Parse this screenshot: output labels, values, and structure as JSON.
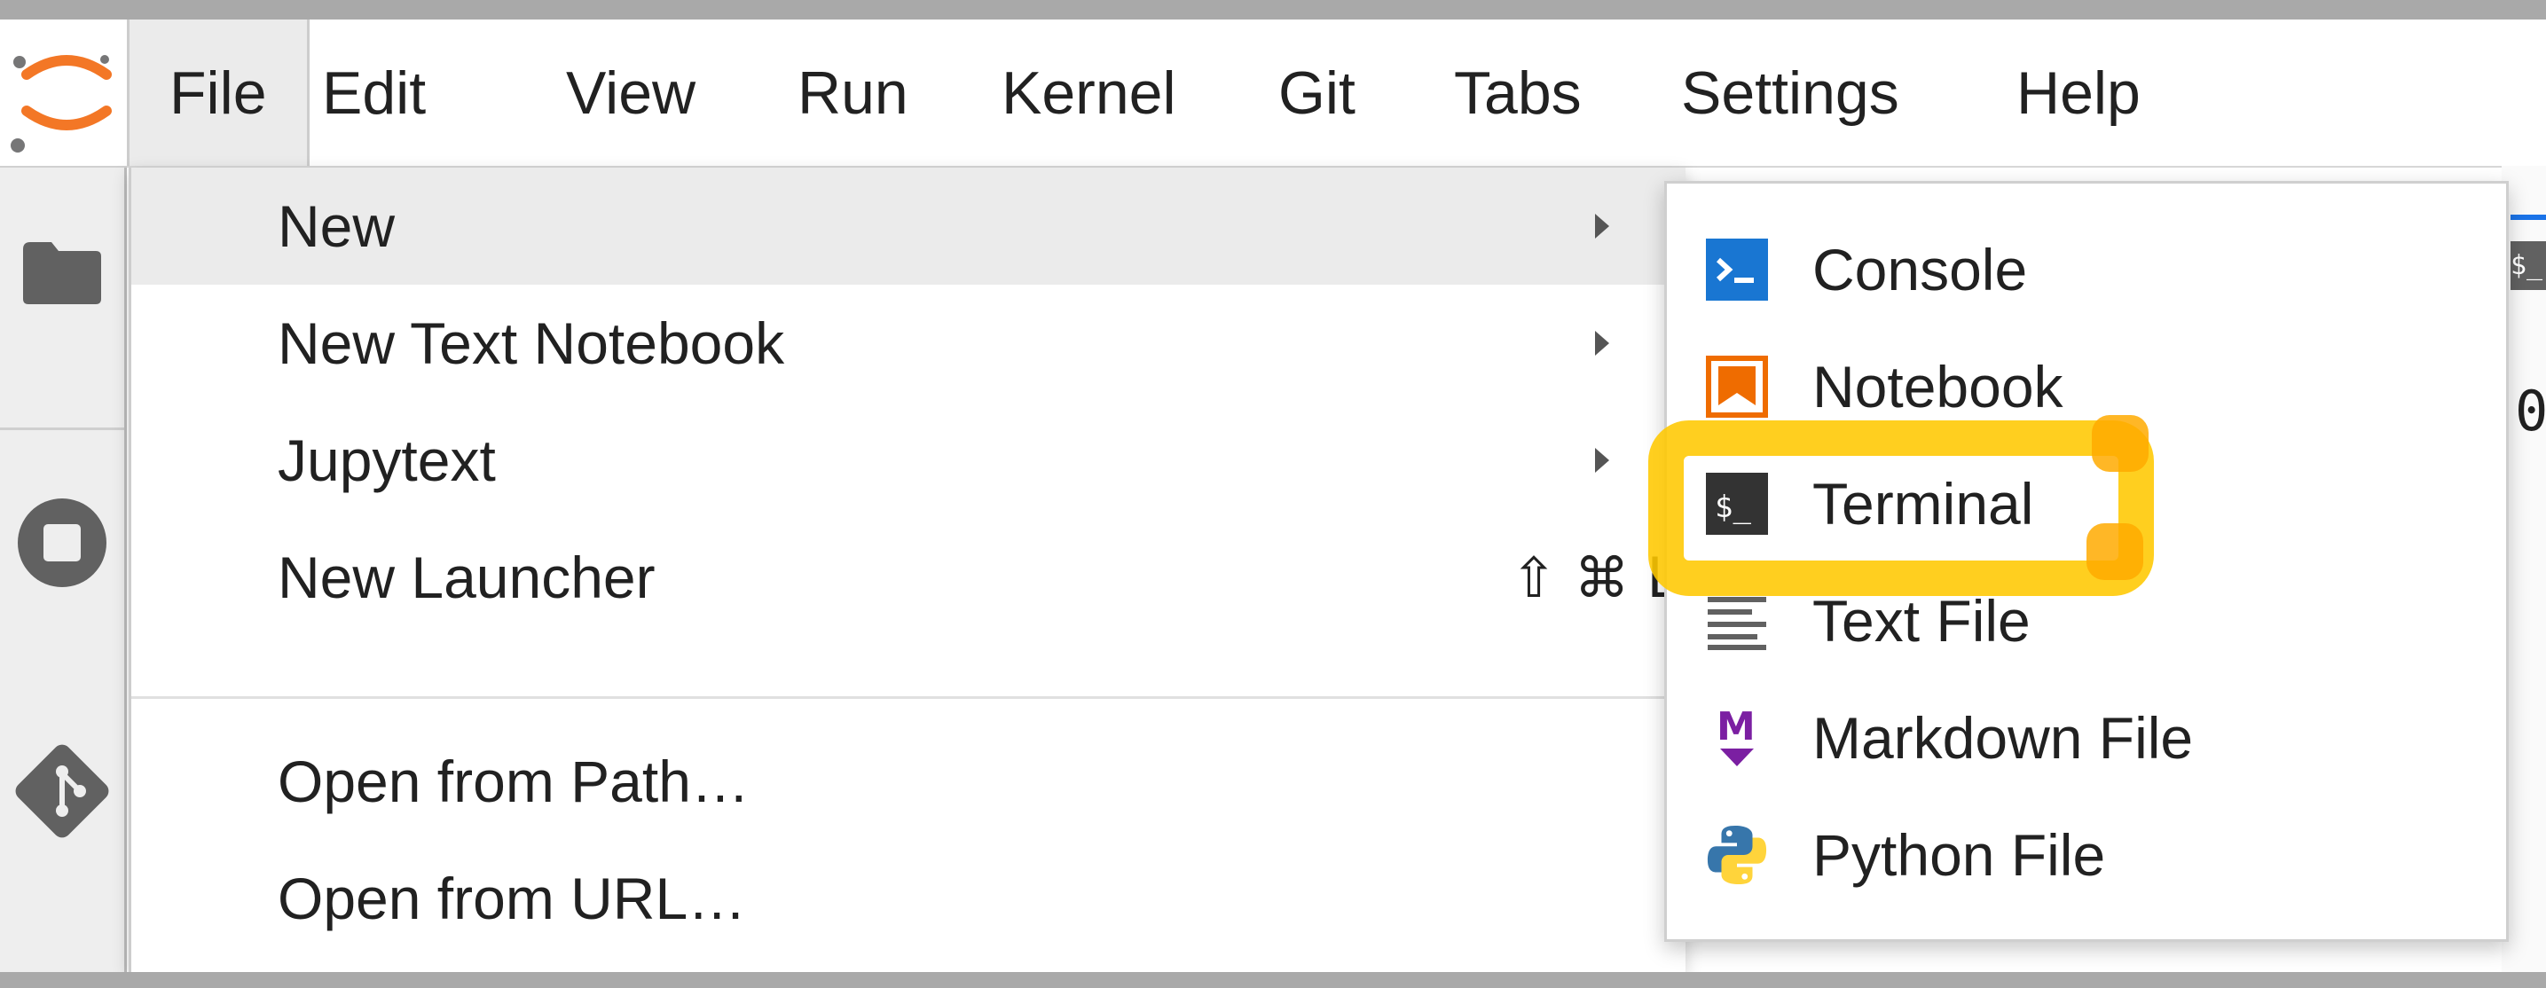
{
  "menubar": {
    "items": [
      {
        "label": "File"
      },
      {
        "label": "Edit"
      },
      {
        "label": "View"
      },
      {
        "label": "Run"
      },
      {
        "label": "Kernel"
      },
      {
        "label": "Git"
      },
      {
        "label": "Tabs"
      },
      {
        "label": "Settings"
      },
      {
        "label": "Help"
      }
    ],
    "active": "File"
  },
  "sidebar": {
    "icons": [
      "jupyter-logo",
      "folder-icon",
      "running-icon",
      "git-icon"
    ]
  },
  "file_menu": {
    "items": [
      {
        "label": "New",
        "submenu": true
      },
      {
        "label": "New Text Notebook",
        "submenu": true
      },
      {
        "label": "Jupytext",
        "submenu": true
      },
      {
        "label": "New Launcher",
        "shortcut": "⇧ ⌘ L"
      },
      {
        "label": "Open from Path…"
      },
      {
        "label": "Open from URL…"
      }
    ]
  },
  "new_submenu": {
    "items": [
      {
        "label": "Console",
        "icon": "console-icon"
      },
      {
        "label": "Notebook",
        "icon": "notebook-icon"
      },
      {
        "label": "Terminal",
        "icon": "terminal-icon"
      },
      {
        "label": "Text File",
        "icon": "text-file-icon"
      },
      {
        "label": "Markdown File",
        "icon": "markdown-icon"
      },
      {
        "label": "Python File",
        "icon": "python-icon"
      }
    ],
    "highlighted": "Terminal"
  },
  "background": {
    "tab_icon_text": "$_",
    "partial_text": "0"
  },
  "colors": {
    "accent": "#1a73e8",
    "highlight": "#ffc800",
    "jupyter_orange": "#f37726"
  }
}
